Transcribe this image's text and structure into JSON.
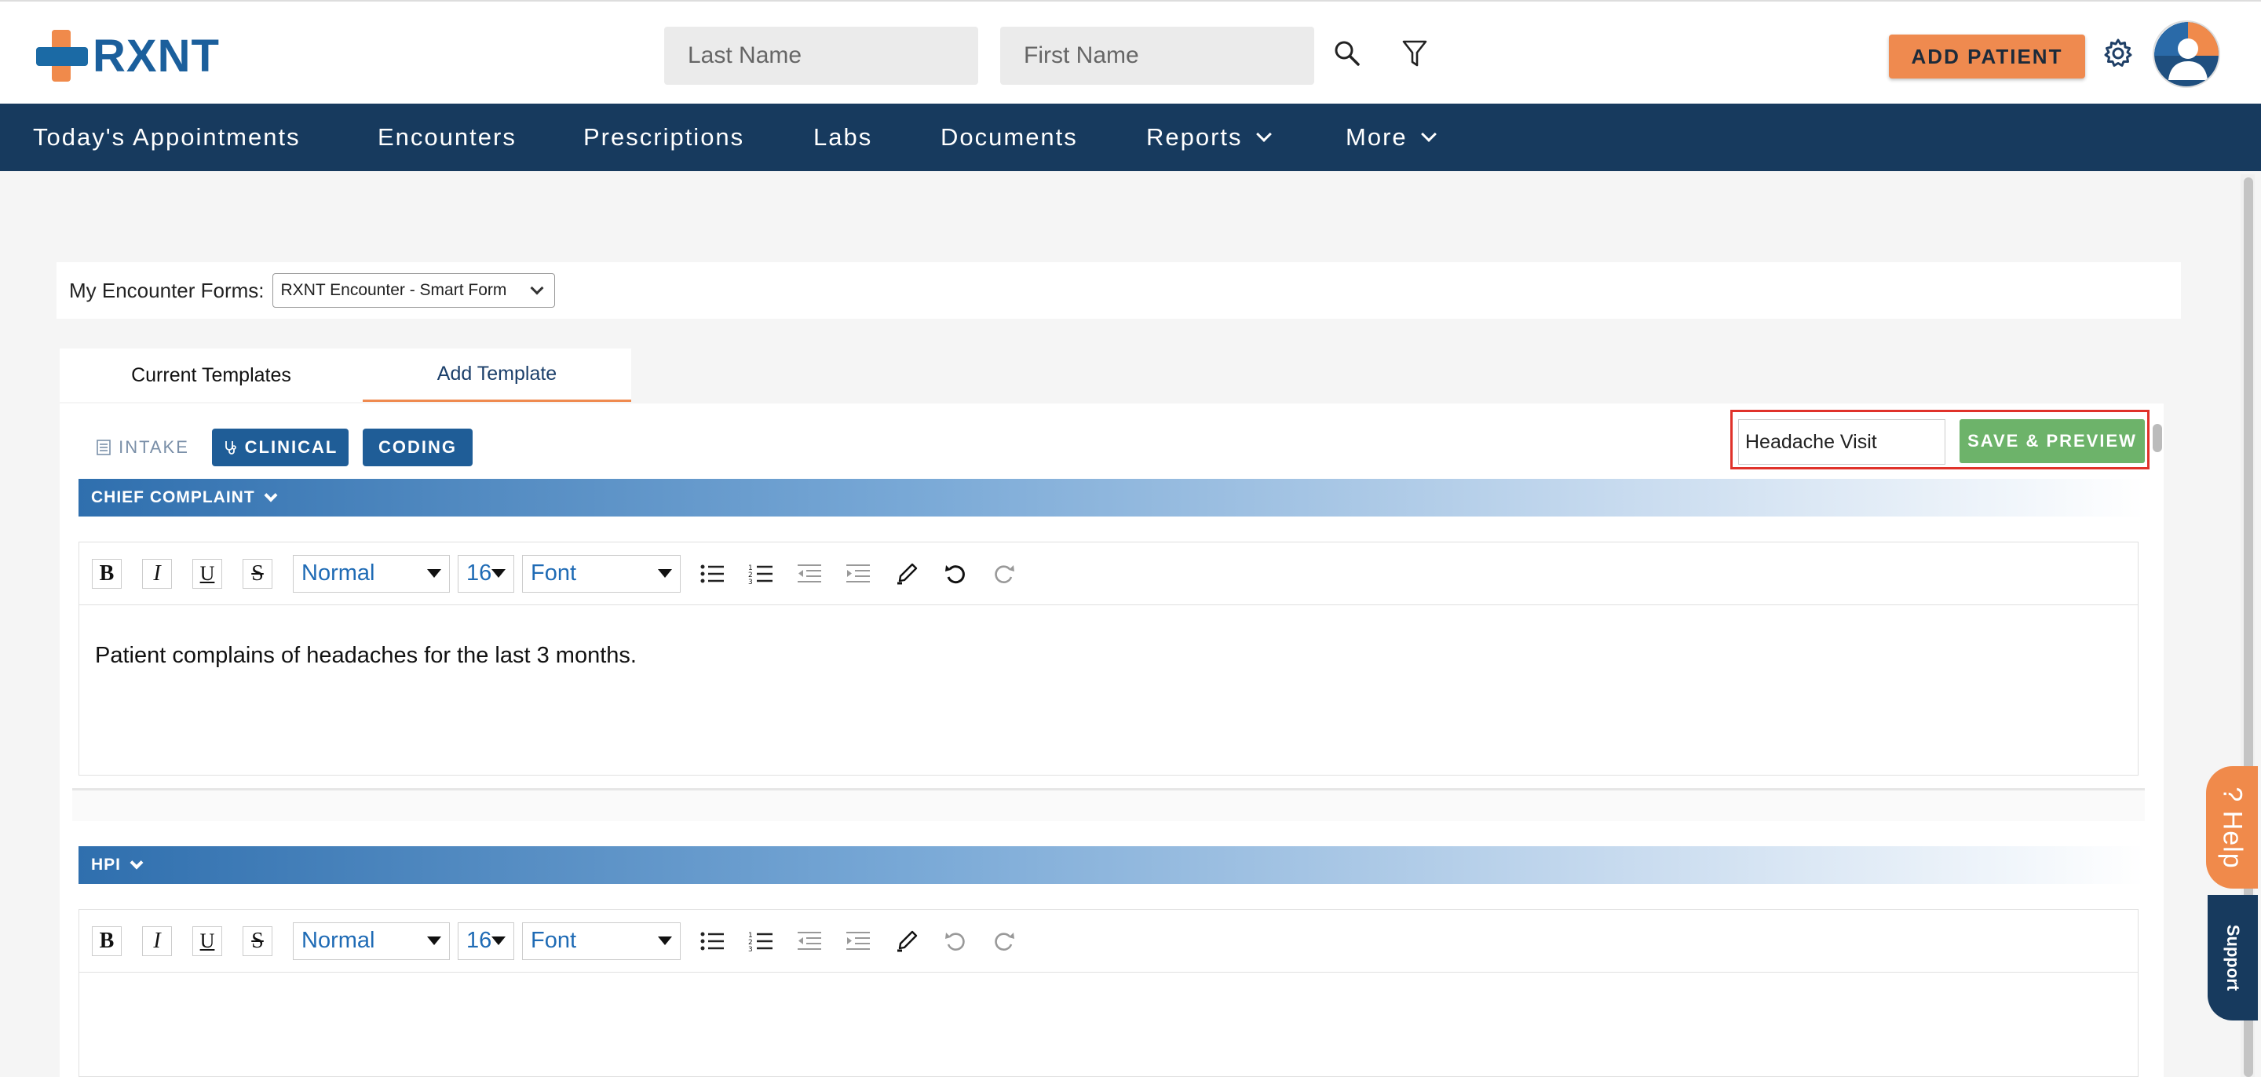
{
  "app": {
    "logo_text": "RXNT"
  },
  "header": {
    "last_name_placeholder": "Last Name",
    "first_name_placeholder": "First Name",
    "add_patient_label": "ADD PATIENT"
  },
  "nav": {
    "items": [
      {
        "label": "Today's Appointments"
      },
      {
        "label": "Encounters"
      },
      {
        "label": "Prescriptions"
      },
      {
        "label": "Labs"
      },
      {
        "label": "Documents"
      },
      {
        "label": "Reports"
      },
      {
        "label": "More"
      }
    ]
  },
  "forms": {
    "label": "My Encounter Forms:",
    "selected": "RXNT Encounter - Smart Form"
  },
  "tabs": [
    {
      "label": "Current Templates"
    },
    {
      "label": "Add Template"
    }
  ],
  "section_tabs": [
    {
      "label": "INTAKE"
    },
    {
      "label": "CLINICAL"
    },
    {
      "label": "CODING"
    }
  ],
  "template": {
    "name": "Headache Visit",
    "save_label": "SAVE & PREVIEW"
  },
  "sections": [
    {
      "title": "CHIEF COMPLAINT",
      "style": "Normal",
      "size": "16",
      "font": "Font",
      "content": "Patient complains of headaches for the last 3 months."
    },
    {
      "title": "HPI",
      "style": "Normal",
      "size": "16",
      "font": "Font",
      "content": ""
    }
  ],
  "widgets": {
    "help_label": "? Help",
    "support_label": "Support"
  },
  "colors": {
    "navbar": "#173a5e",
    "accent_orange": "#ef8a4f",
    "primary_blue": "#1f5d97",
    "save_green": "#6db36a",
    "highlight_red": "#e0322a"
  }
}
